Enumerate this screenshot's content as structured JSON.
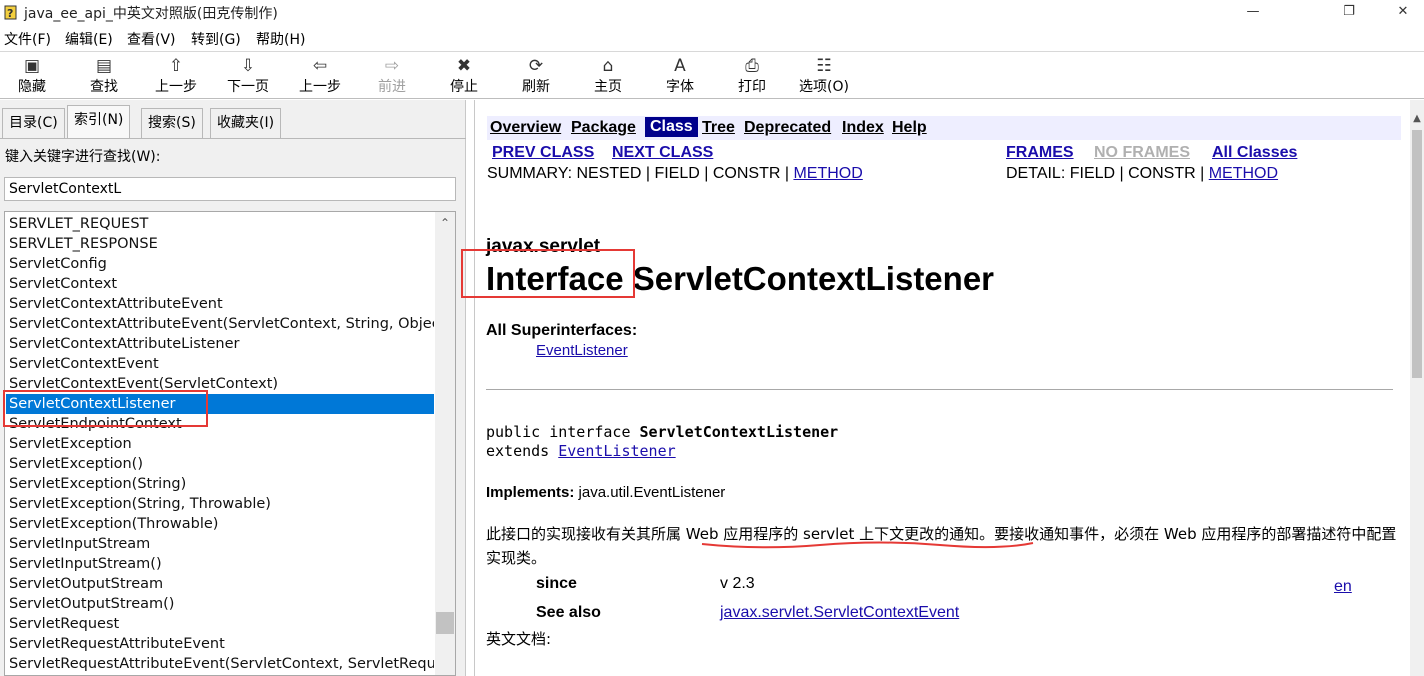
{
  "window": {
    "title": "java_ee_api_中英文对照版(田克传制作)",
    "minimize_glyph": "—",
    "restore_glyph": "❐",
    "close_glyph": "✕"
  },
  "menu": [
    "文件(F)",
    "编辑(E)",
    "查看(V)",
    "转到(G)",
    "帮助(H)"
  ],
  "toolbar": [
    {
      "label": "隐藏",
      "icon": "hide-icon",
      "glyph": "▣",
      "enabled": true
    },
    {
      "label": "查找",
      "icon": "find-icon",
      "glyph": "▤",
      "enabled": true
    },
    {
      "label": "上一步",
      "icon": "up-arrow-icon",
      "glyph": "⇧",
      "enabled": true
    },
    {
      "label": "下一页",
      "icon": "down-arrow-icon",
      "glyph": "⇩",
      "enabled": true
    },
    {
      "label": "上一步",
      "icon": "back-arrow-icon",
      "glyph": "⇦",
      "enabled": true
    },
    {
      "label": "前进",
      "icon": "forward-arrow-icon",
      "glyph": "⇨",
      "enabled": false
    },
    {
      "label": "停止",
      "icon": "stop-icon",
      "glyph": "✖",
      "enabled": true
    },
    {
      "label": "刷新",
      "icon": "refresh-icon",
      "glyph": "⟳",
      "enabled": true
    },
    {
      "label": "主页",
      "icon": "home-icon",
      "glyph": "⌂",
      "enabled": true
    },
    {
      "label": "字体",
      "icon": "font-icon",
      "glyph": "A",
      "enabled": true
    },
    {
      "label": "打印",
      "icon": "print-icon",
      "glyph": "⎙",
      "enabled": true
    },
    {
      "label": "选项(O)",
      "icon": "options-icon",
      "glyph": "☷",
      "enabled": true
    }
  ],
  "tabs": [
    "目录(C)",
    "索引(N)",
    "搜索(S)",
    "收藏夹(I)"
  ],
  "active_tab": "索引(N)",
  "index": {
    "label": "键入关键字进行查找(W):",
    "query": "ServletContextL",
    "items": [
      "SERVLET_REQUEST",
      "SERVLET_RESPONSE",
      "ServletConfig",
      "ServletContext",
      "ServletContextAttributeEvent",
      "ServletContextAttributeEvent(ServletContext, String, Object)",
      "ServletContextAttributeListener",
      "ServletContextEvent",
      "ServletContextEvent(ServletContext)",
      "ServletContextListener",
      "ServletEndpointContext",
      "ServletException",
      "ServletException()",
      "ServletException(String)",
      "ServletException(String, Throwable)",
      "ServletException(Throwable)",
      "ServletInputStream",
      "ServletInputStream()",
      "ServletOutputStream",
      "ServletOutputStream()",
      "ServletRequest",
      "ServletRequestAttributeEvent",
      "ServletRequestAttributeEvent(ServletContext, ServletRequest, String, Object)"
    ],
    "selected": "ServletContextListener",
    "scroll_up_glyph": "⌃"
  },
  "doc": {
    "navbar": [
      "Overview",
      "Package",
      "Class",
      "Tree",
      "Deprecated",
      "Index",
      "Help"
    ],
    "navbar_current": "Class",
    "prev_class": "PREV CLASS",
    "next_class": "NEXT CLASS",
    "frames": "FRAMES",
    "no_frames": "NO FRAMES",
    "all_classes": "All Classes",
    "summary_prefix": "SUMMARY: NESTED | FIELD | CONSTR | ",
    "summary_method": "METHOD",
    "detail_prefix": "DETAIL: FIELD | CONSTR | ",
    "detail_method": "METHOD",
    "package": "javax.servlet",
    "title_kind": "Interface ",
    "title_name": "ServletContextListener",
    "superinterfaces_label": "All Superinterfaces:",
    "superinterface": "EventListener",
    "code_line1_prefix": "public interface ",
    "code_line1_name": "ServletContextListener",
    "code_line2_prefix": "extends ",
    "code_line2_link": "EventListener",
    "implements_label": "Implements:",
    "implements_value": " java.util.EventListener",
    "description": "此接口的实现接收有关其所属 Web 应用程序的 servlet 上下文更改的通知。要接收通知事件，必须在 Web 应用程序的部署描述符中配置实现类。",
    "since_label": "since",
    "since_value": "v 2.3",
    "lang_link": "en",
    "see_also_label": "See also",
    "see_also_value": "javax.servlet.ServletContextEvent",
    "english_doc": "英文文档:"
  },
  "colors": {
    "selection": "#0078d7",
    "nav_current_bg": "#00008b",
    "navbar_bg": "#eeeeff",
    "link": "#1a0dab",
    "annotation": "#e53935"
  }
}
